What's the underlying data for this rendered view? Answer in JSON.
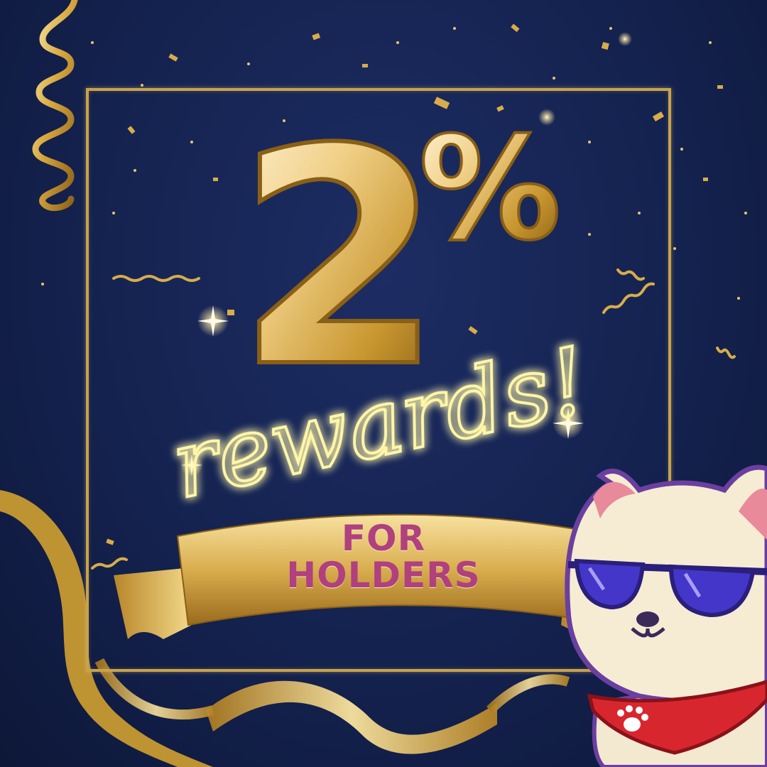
{
  "headline": {
    "number": "2",
    "percent_sign": "%"
  },
  "tagline": "rewards!",
  "banner": {
    "line1": "FOR",
    "line2": "HOLDERS"
  },
  "colors": {
    "background": "#14224f",
    "gold": "#d9b35e",
    "gold_light": "#f5e3b0",
    "neon": "#fff6a8",
    "banner_text": "#b0407e",
    "bandana": "#d8262f",
    "sunglasses": "#4436c8"
  },
  "mascot": {
    "icon": "cat-mascot-icon",
    "accessories": [
      "sunglasses-icon",
      "bandana-icon",
      "paw-print-icon"
    ]
  }
}
